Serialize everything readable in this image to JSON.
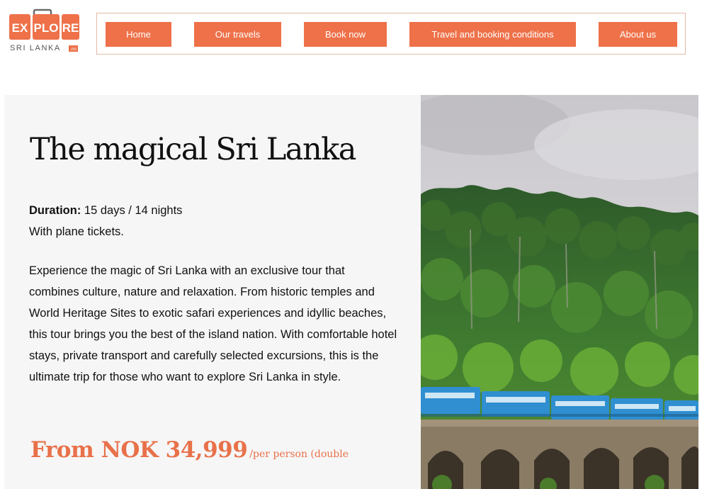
{
  "logo": {
    "letters_1": "EX",
    "letters_2": "PLO",
    "letters_3": "RE",
    "subtitle": "SRI LANKA",
    "suffix": ".no"
  },
  "nav": {
    "items": [
      {
        "label": "Home"
      },
      {
        "label": "Our travels"
      },
      {
        "label": "Book now"
      },
      {
        "label": "Travel and booking conditions"
      },
      {
        "label": "About us"
      }
    ]
  },
  "hero": {
    "title": "The magical Sri Lanka",
    "duration_label": "Duration:",
    "duration_value": "15 days / 14 nights",
    "plane_note": "With plane tickets.",
    "description": "Experience the magic of Sri Lanka with an exclusive tour that combines culture, nature and relaxation. From historic temples and World Heritage Sites to exotic safari experiences and idyllic beaches, this tour brings you the best of the island nation. With comfortable hotel stays, private transport and carefully selected excursions, this is the ultimate trip for those who want to explore Sri Lanka in style.",
    "price_main": "From NOK 34,999",
    "price_unit": "/per person (double"
  },
  "colors": {
    "accent": "#ee7149",
    "panel_bg": "#f6f6f6",
    "nav_border": "#e2b9a6",
    "train_blue": "#2f8fd0"
  },
  "image": {
    "icon": "train-on-bridge-photo"
  }
}
